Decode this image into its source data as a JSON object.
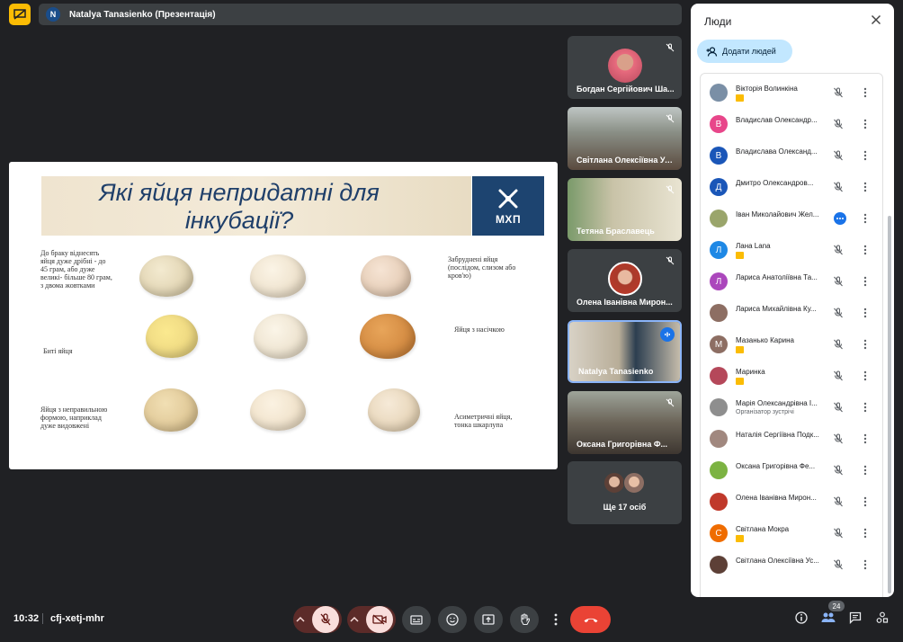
{
  "header": {
    "presenter_initial": "N",
    "title": "Natalya Tanasienko (Презентація)"
  },
  "slide": {
    "title_line1": "Які яйця непридатні для",
    "title_line2": "інкубації?",
    "logo_text": "МХП",
    "captions": [
      "До браку віднесять яйця дуже дрібні - до 45 грам, або дуже великі- більше 80 грам, з двома жовтками",
      "Забруднені яйця (послідом, слизом або кров'ю)",
      "Биті яйця",
      "Яйця з насічкою",
      "Яйця з неправильною формою, наприклад дуже видовжені",
      "Асиметричні яйця, тонка шкарлупа"
    ]
  },
  "tiles": [
    {
      "name": "Богдан Сергійович Ша..."
    },
    {
      "name": "Світлана Олексіївна Ус..."
    },
    {
      "name": "Тетяна Браславець"
    },
    {
      "name": "Олена Іванівна Мирон..."
    },
    {
      "name": "Natalya Tanasienko"
    },
    {
      "name": "Оксана Григорівна Ф..."
    },
    {
      "name": "Ще 17 осіб"
    }
  ],
  "panel": {
    "title": "Люди",
    "add_people": "Додати людей",
    "participants": [
      {
        "name": "Вікторія Волинкіна",
        "initial": "",
        "color": "#7a8fa6",
        "sub": "",
        "badge": true
      },
      {
        "name": "Владислав Олександр...",
        "initial": "В",
        "color": "#e8468a",
        "sub": "",
        "badge": false
      },
      {
        "name": "Владислава Олександ...",
        "initial": "В",
        "color": "#1a56b8",
        "sub": "",
        "badge": false
      },
      {
        "name": "Дмитро Олександров...",
        "initial": "Д",
        "color": "#1a56b8",
        "sub": "",
        "badge": false
      },
      {
        "name": "Іван Миколайович Жел...",
        "initial": "",
        "color": "#9aa56b",
        "sub": "",
        "badge": false,
        "speaking": true
      },
      {
        "name": "Лана Lana",
        "initial": "Л",
        "color": "#1e88e5",
        "sub": "",
        "badge": true
      },
      {
        "name": "Лариса Анатоліївна Та...",
        "initial": "Л",
        "color": "#ab47bc",
        "sub": "",
        "badge": false
      },
      {
        "name": "Лариса Михайлівна Ку...",
        "initial": "",
        "color": "#8d6e63",
        "sub": "",
        "badge": false
      },
      {
        "name": "Мазанько Карина",
        "initial": "М",
        "color": "#8d6e63",
        "sub": "",
        "badge": true
      },
      {
        "name": "Маринка",
        "initial": "",
        "color": "#b5485a",
        "sub": "",
        "badge": true
      },
      {
        "name": "Марія Олександрівна І...",
        "initial": "",
        "color": "#8e8e8e",
        "sub": "Організатор зустрічі",
        "badge": false
      },
      {
        "name": "Наталія Сергіївна Подк...",
        "initial": "",
        "color": "#a1887f",
        "sub": "",
        "badge": false
      },
      {
        "name": "Оксана Григорівна Фе...",
        "initial": "",
        "color": "#7cb342",
        "sub": "",
        "badge": false
      },
      {
        "name": "Олена Іванівна Мирон...",
        "initial": "",
        "color": "#c0392b",
        "sub": "",
        "badge": false
      },
      {
        "name": "Світлана Мокра",
        "initial": "С",
        "color": "#ef6c00",
        "sub": "",
        "badge": true
      },
      {
        "name": "Світлана Олексіївна Ус...",
        "initial": "",
        "color": "#5d4037",
        "sub": "",
        "badge": false
      }
    ]
  },
  "bottom": {
    "time": "10:32",
    "meeting_code": "cfj-xetj-mhr",
    "people_count": "24"
  }
}
